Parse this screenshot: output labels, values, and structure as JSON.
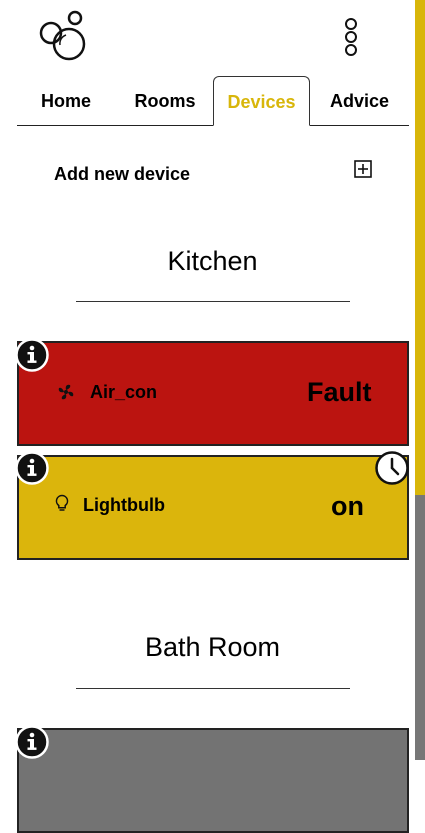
{
  "nav": {
    "tabs": [
      {
        "label": "Home",
        "active": false
      },
      {
        "label": "Rooms",
        "active": false
      },
      {
        "label": "Devices",
        "active": true
      },
      {
        "label": "Advice",
        "active": false
      }
    ]
  },
  "actions": {
    "add_device_label": "Add new device",
    "add_icon": "plus-square-icon"
  },
  "rooms": [
    {
      "name": "Kitchen",
      "devices": [
        {
          "name": "Air_con",
          "state": "Fault",
          "icon": "fan-icon",
          "color": "#bb1410",
          "has_info": true,
          "has_schedule": false
        },
        {
          "name": "Lightbulb",
          "state": "on",
          "icon": "lightbulb-icon",
          "color": "#dbb50c",
          "has_info": true,
          "has_schedule": true
        }
      ]
    },
    {
      "name": "Bath Room",
      "devices": [
        {
          "name": "",
          "state": "",
          "icon": "",
          "color": "#737373",
          "has_info": true,
          "has_schedule": false
        }
      ]
    }
  ],
  "theme": {
    "accent": "#d8b60a",
    "fault": "#bb1410",
    "on": "#dbb50c",
    "off": "#737373"
  }
}
